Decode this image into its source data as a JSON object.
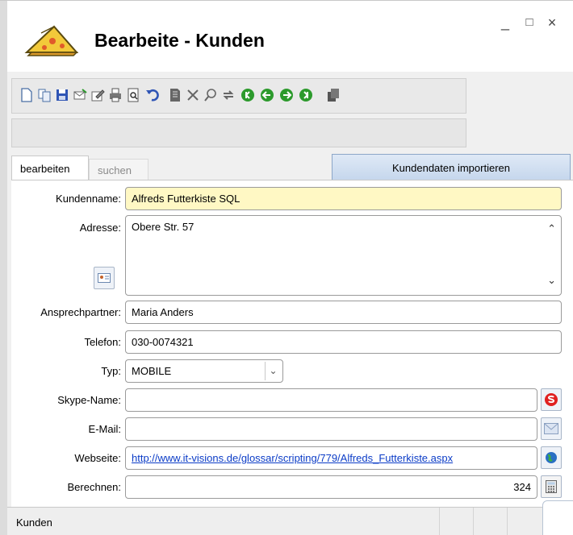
{
  "window": {
    "title": "Bearbeite - Kunden",
    "minimize": "_",
    "maximize": "□",
    "close": "×"
  },
  "tabs": [
    {
      "label": "bearbeiten",
      "active": true
    },
    {
      "label": "suchen",
      "active": false
    }
  ],
  "import_button": "Kundendaten importieren",
  "form": {
    "kundenname": {
      "label": "Kundenname:",
      "value": "Alfreds Futterkiste SQL"
    },
    "adresse": {
      "label": "Adresse:",
      "value": "Obere Str. 57"
    },
    "ansprechpartner": {
      "label": "Ansprechpartner:",
      "value": "Maria Anders"
    },
    "telefon": {
      "label": "Telefon:",
      "value": "030-0074321"
    },
    "typ": {
      "label": "Typ:",
      "value": "MOBILE"
    },
    "skype": {
      "label": "Skype-Name:",
      "value": ""
    },
    "email": {
      "label": "E-Mail:",
      "value": ""
    },
    "webseite": {
      "label": "Webseite:",
      "value": "http://www.it-visions.de/glossar/scripting/779/Alfreds_Futterkiste.aspx"
    },
    "berechnen": {
      "label": "Berechnen:",
      "value": "324"
    }
  },
  "toolbar_icons": [
    "new-document-icon",
    "copy-document-icon",
    "save-icon",
    "mail-icon",
    "edit-icon",
    "print-icon",
    "print-preview-icon",
    "undo-icon",
    "delete-document-icon",
    "cancel-icon",
    "search-icon",
    "refresh-icon",
    "first-record-icon",
    "previous-record-icon",
    "next-record-icon",
    "last-record-icon",
    "export-icon"
  ],
  "status": {
    "text": "Kunden"
  },
  "colors": {
    "accent_green": "#2c9a2c",
    "required_yellow": "#fff8c4",
    "link_blue": "#0b3cc7"
  }
}
